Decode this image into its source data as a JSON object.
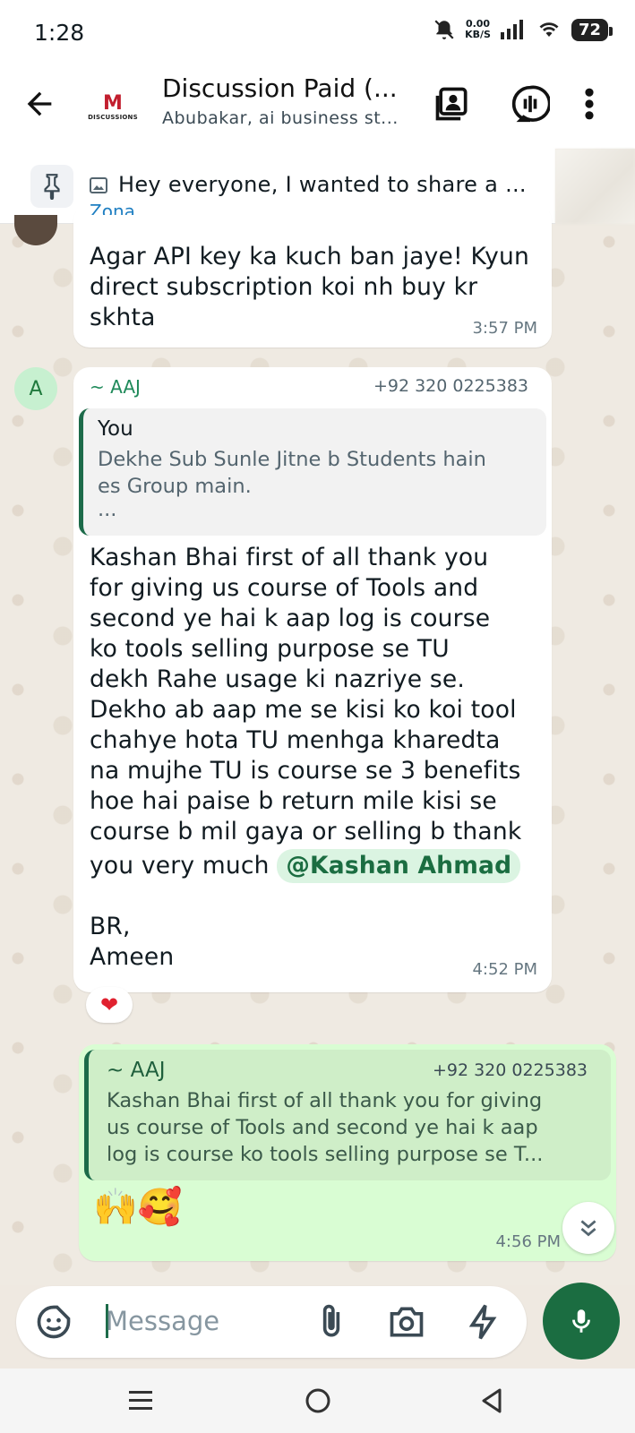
{
  "status": {
    "time": "1:28",
    "net_speed_value": "0.00",
    "net_speed_unit": "KB/S",
    "battery": "72"
  },
  "header": {
    "title": "Discussion Paid (...",
    "subtitle": "Abubakar, ai business st...",
    "logo_text": "DISCUSSIONS"
  },
  "pinned": {
    "text": "Hey everyone, I wanted to share a ..."
  },
  "messages": [
    {
      "sender": "Zona",
      "text_lines": [
        "Agar API key ka kuch ban jaye! Kyun",
        "direct subscription koi nh buy kr",
        "skhta"
      ],
      "time": "3:57 PM"
    },
    {
      "avatar_letter": "A",
      "sender": "~ AAJ",
      "phone": "+92 320 0225383",
      "quote": {
        "name": "You",
        "lines": [
          "Dekhe Sub Sunle Jitne b Students hain",
          "es Group main.",
          "..."
        ]
      },
      "text_lines": [
        "Kashan Bhai first of all thank you",
        "for giving us course of Tools and",
        "second ye hai k aap log is course",
        "ko tools selling purpose se TU",
        "dekh Rahe usage ki nazriye se.",
        "Dekho ab aap me se kisi ko koi tool",
        "chahye hota TU menhga kharedta",
        "na mujhe TU is course se 3 benefits",
        "hoe hai paise b return mile kisi se",
        "course b mil gaya or selling b thank"
      ],
      "last_line": "you very much",
      "mention": "@Kashan Ahmad",
      "signoff_1": "BR,",
      "signoff_2": "Ameen",
      "time": "4:52 PM",
      "reaction": "❤"
    },
    {
      "quote": {
        "name": "~ AAJ",
        "phone": "+92 320 0225383",
        "lines": [
          "Kashan Bhai first of all thank you for giving",
          "us course of Tools and second ye hai k aap",
          "log is course ko tools selling purpose se T..."
        ]
      },
      "emojis": "🙌🥰",
      "time": "4:56 PM"
    }
  ],
  "input": {
    "placeholder": "Message"
  },
  "colors": {
    "accent": "#1b6d41",
    "outgoing_bubble": "#d9fdd3",
    "mention_bg": "#dbf4e2"
  }
}
